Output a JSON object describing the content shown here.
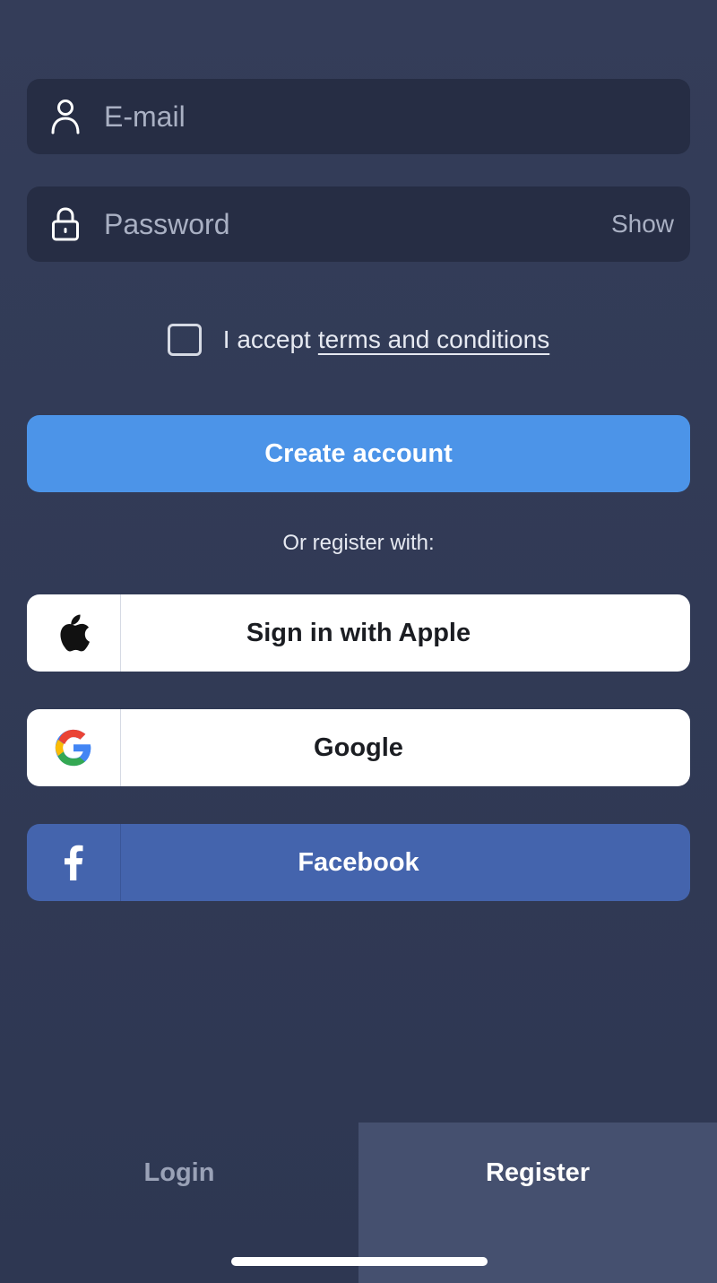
{
  "form": {
    "email": {
      "value": "",
      "placeholder": "E-mail",
      "icon": "user-icon"
    },
    "password": {
      "value": "",
      "placeholder": "Password",
      "icon": "lock-icon",
      "show_label": "Show"
    },
    "terms": {
      "checked": false,
      "prefix": "I accept",
      "link_text": "terms and conditions"
    },
    "create_button_label": "Create account"
  },
  "social": {
    "heading": "Or register with:",
    "apple": {
      "label": "Sign in with Apple",
      "icon": "apple-icon"
    },
    "google": {
      "label": "Google",
      "icon": "google-icon"
    },
    "facebook": {
      "label": "Facebook",
      "icon": "facebook-icon"
    }
  },
  "tabs": {
    "login": "Login",
    "register": "Register",
    "active": "register"
  },
  "colors": {
    "background": "#343d59",
    "field": "#262d44",
    "primary": "#4c94e8",
    "facebook": "#4464ad",
    "active_tab": "#45506f"
  }
}
